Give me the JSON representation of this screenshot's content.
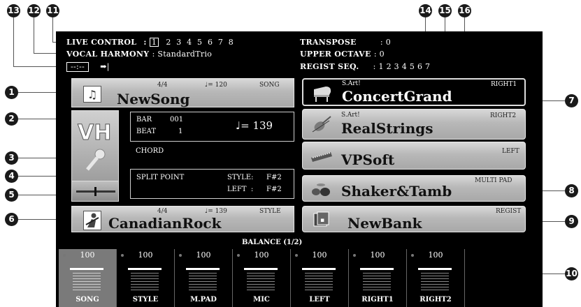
{
  "callouts": [
    "13",
    "12",
    "11",
    "14",
    "15",
    "16",
    "1",
    "2",
    "3",
    "4",
    "5",
    "6",
    "7",
    "8",
    "9",
    "10"
  ],
  "header": {
    "live_control_label": "LIVE CONTROL",
    "live_control_colon": ":",
    "live_control_current": "1",
    "live_control_others": "2  3  4  5  6  7  8",
    "vocal_harmony_label": "VOCAL HARMONY",
    "vocal_harmony_value": ": StandardTrio",
    "timer_value": "--:--",
    "timer_reset_glyph": "➡|",
    "transpose_label": "TRANSPOSE",
    "transpose_value": ": 0",
    "upper_octave_label": "UPPER OCTAVE",
    "upper_octave_value": ": 0",
    "regist_seq_label": "REGIST SEQ.",
    "regist_seq_value": ": 1 2 3 4 5 6 7"
  },
  "song": {
    "name": "NewSong",
    "time_sig": "4/4",
    "tempo_note": "♩=",
    "tempo": "120",
    "tag": "SONG",
    "icon": "music-note-icon"
  },
  "position": {
    "bar_label": "BAR",
    "bar_value": "001",
    "beat_label": "BEAT",
    "beat_value": "1",
    "tempo_note": "♩=",
    "tempo": "139"
  },
  "vh_button": {
    "label": "VH",
    "icon": "vocal-harmony-mic-icon"
  },
  "chord": {
    "label": "CHORD"
  },
  "split": {
    "label": "SPLIT POINT",
    "style_label": "STYLE:",
    "style_value": "F#2",
    "left_label": "LEFT  :",
    "left_value": "F#2"
  },
  "style": {
    "name": "CanadianRock",
    "time_sig": "4/4",
    "tempo_note": "♩=",
    "tempo": "139",
    "tag": "STYLE",
    "icon": "guitar-player-icon"
  },
  "voices": [
    {
      "name": "ConcertGrand",
      "prefix": "S.Art!",
      "tag": "RIGHT1",
      "icon": "grand-piano-icon",
      "selected": true
    },
    {
      "name": "RealStrings",
      "prefix": "S.Art!",
      "tag": "RIGHT2",
      "icon": "violin-icon",
      "selected": false
    },
    {
      "name": "VPSoft",
      "prefix": "",
      "tag": "LEFT",
      "icon": "keyboard-icon",
      "selected": false
    }
  ],
  "multipad": {
    "name": "Shaker&Tamb",
    "tag": "MULTI PAD",
    "icon": "drum-kit-icon"
  },
  "regist": {
    "name": "NewBank",
    "tag": "REGIST",
    "icon": "regist-bank-icon"
  },
  "balance": {
    "title": "BALANCE (1/2)",
    "channels": [
      {
        "label": "SONG",
        "level": "100",
        "selected": true
      },
      {
        "label": "STYLE",
        "level": "100",
        "selected": false
      },
      {
        "label": "M.PAD",
        "level": "100",
        "selected": false
      },
      {
        "label": "MIC",
        "level": "100",
        "selected": false
      },
      {
        "label": "LEFT",
        "level": "100",
        "selected": false
      },
      {
        "label": "RIGHT1",
        "level": "100",
        "selected": false
      },
      {
        "label": "RIGHT2",
        "level": "100",
        "selected": false
      }
    ]
  },
  "colors": {
    "screen": "#000000",
    "panel_light": "#d8d8d8",
    "panel_dark": "#a8a8a8",
    "callout": "#1a1a1a"
  }
}
